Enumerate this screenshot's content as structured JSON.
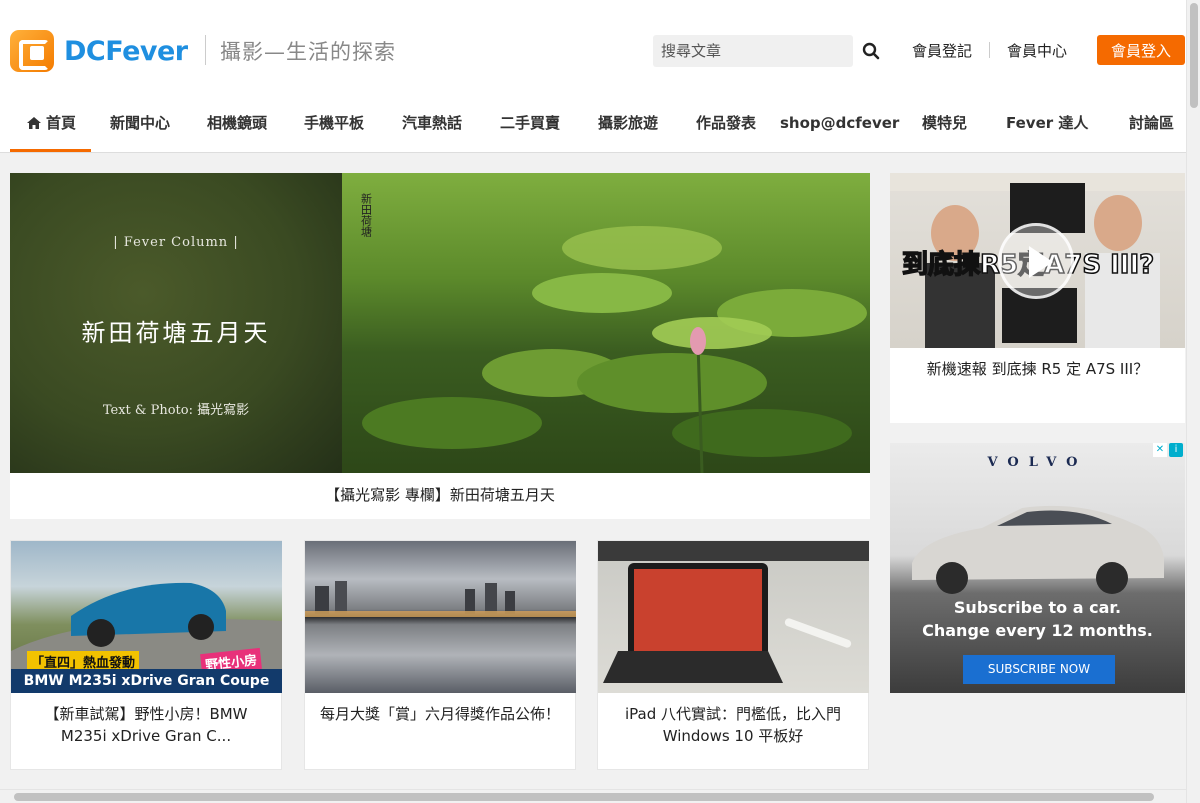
{
  "site": {
    "logo_text": "DCFever",
    "tagline": "攝影—生活的探索"
  },
  "search": {
    "placeholder": "搜尋文章"
  },
  "account": {
    "register": "會員登記",
    "center": "會員中心",
    "login": "會員登入"
  },
  "nav": [
    {
      "label": "首頁",
      "icon": "home-icon",
      "active": true
    },
    {
      "label": "新聞中心"
    },
    {
      "label": "相機鏡頭"
    },
    {
      "label": "手機平板"
    },
    {
      "label": "汽車熱話"
    },
    {
      "label": "二手買賣"
    },
    {
      "label": "攝影旅遊"
    },
    {
      "label": "作品發表"
    },
    {
      "label": "shop@dcfever"
    },
    {
      "label": "模特兒"
    },
    {
      "label": "Fever 達人"
    },
    {
      "label": "討論區"
    }
  ],
  "feature": {
    "column_label": "| Fever Column |",
    "image_title": "新田荷塘五月天",
    "image_credit": "Text & Photo: 攝光寫影",
    "caption": "【攝光寫影 專欄】新田荷塘五月天"
  },
  "cards": [
    {
      "caption": "【新車試駕】野性小房！BMW M235i xDrive Gran C...",
      "overlay_top": "「直四」熱血發動",
      "overlay_tag": "野性小房",
      "overlay_bottom": "BMW M235i xDrive Gran Coupe"
    },
    {
      "caption": "每月大獎「賞」六月得獎作品公佈！"
    },
    {
      "caption": "iPad 八代實試：門檻低，比入門 Windows 10 平板好"
    }
  ],
  "video": {
    "overlay_text": "到底揀R5定A7S III?",
    "caption": "新機速報 到底揀 R5 定 A7S III？"
  },
  "ad": {
    "brand": "VOLVO",
    "line1": "Subscribe to a car.",
    "line2": "Change every 12 months.",
    "button": "SUBSCRIBE NOW"
  },
  "colors": {
    "accent": "#f56a00",
    "logo_blue": "#1f8fe0"
  }
}
